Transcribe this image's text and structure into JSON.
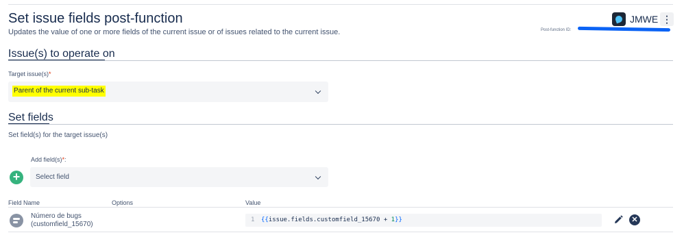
{
  "header": {
    "title": "Set issue fields post-function",
    "subtitle": "Updates the value of one or more fields of the current issue or of issues related to the current issue.",
    "app_name": "JMWE",
    "more_icon": "⋮",
    "post_function_id_label": "Post-function ID:"
  },
  "issues_section": {
    "heading": "Issue(s) to operate on",
    "target_label": "Target issue(s)",
    "required_mark": "*",
    "target_value": "Parent of the current sub-task"
  },
  "fields_section": {
    "heading": "Set fields",
    "description": "Set field(s) for the target issue(s)",
    "add_label": "Add field(s)",
    "required_mark": "*",
    "add_colon": ":",
    "add_icon": "+",
    "select_placeholder": "Select field"
  },
  "table": {
    "headers": {
      "field_name": "Field Name",
      "options": "Options",
      "value": "Value"
    },
    "rows": [
      {
        "field_name": "Número de bugs",
        "field_id": "(customfield_15670)",
        "line_number": "1",
        "value_open": "{{",
        "value_expr": "issue.fields.customfield_15670 + ",
        "value_num": "1",
        "value_close": "}}"
      }
    ]
  },
  "icons": {
    "app_logo": "jmwe-logo-icon",
    "add": "plus-circle-icon",
    "field_type": "field-type-icon",
    "edit": "pencil-icon",
    "remove": "close-circle-icon",
    "dropdown": "chevron-down-icon"
  },
  "colors": {
    "accent_green": "#36b37e",
    "highlight": "#ffff00",
    "redaction_blue": "#0b63f5",
    "required_red": "#de350b"
  }
}
